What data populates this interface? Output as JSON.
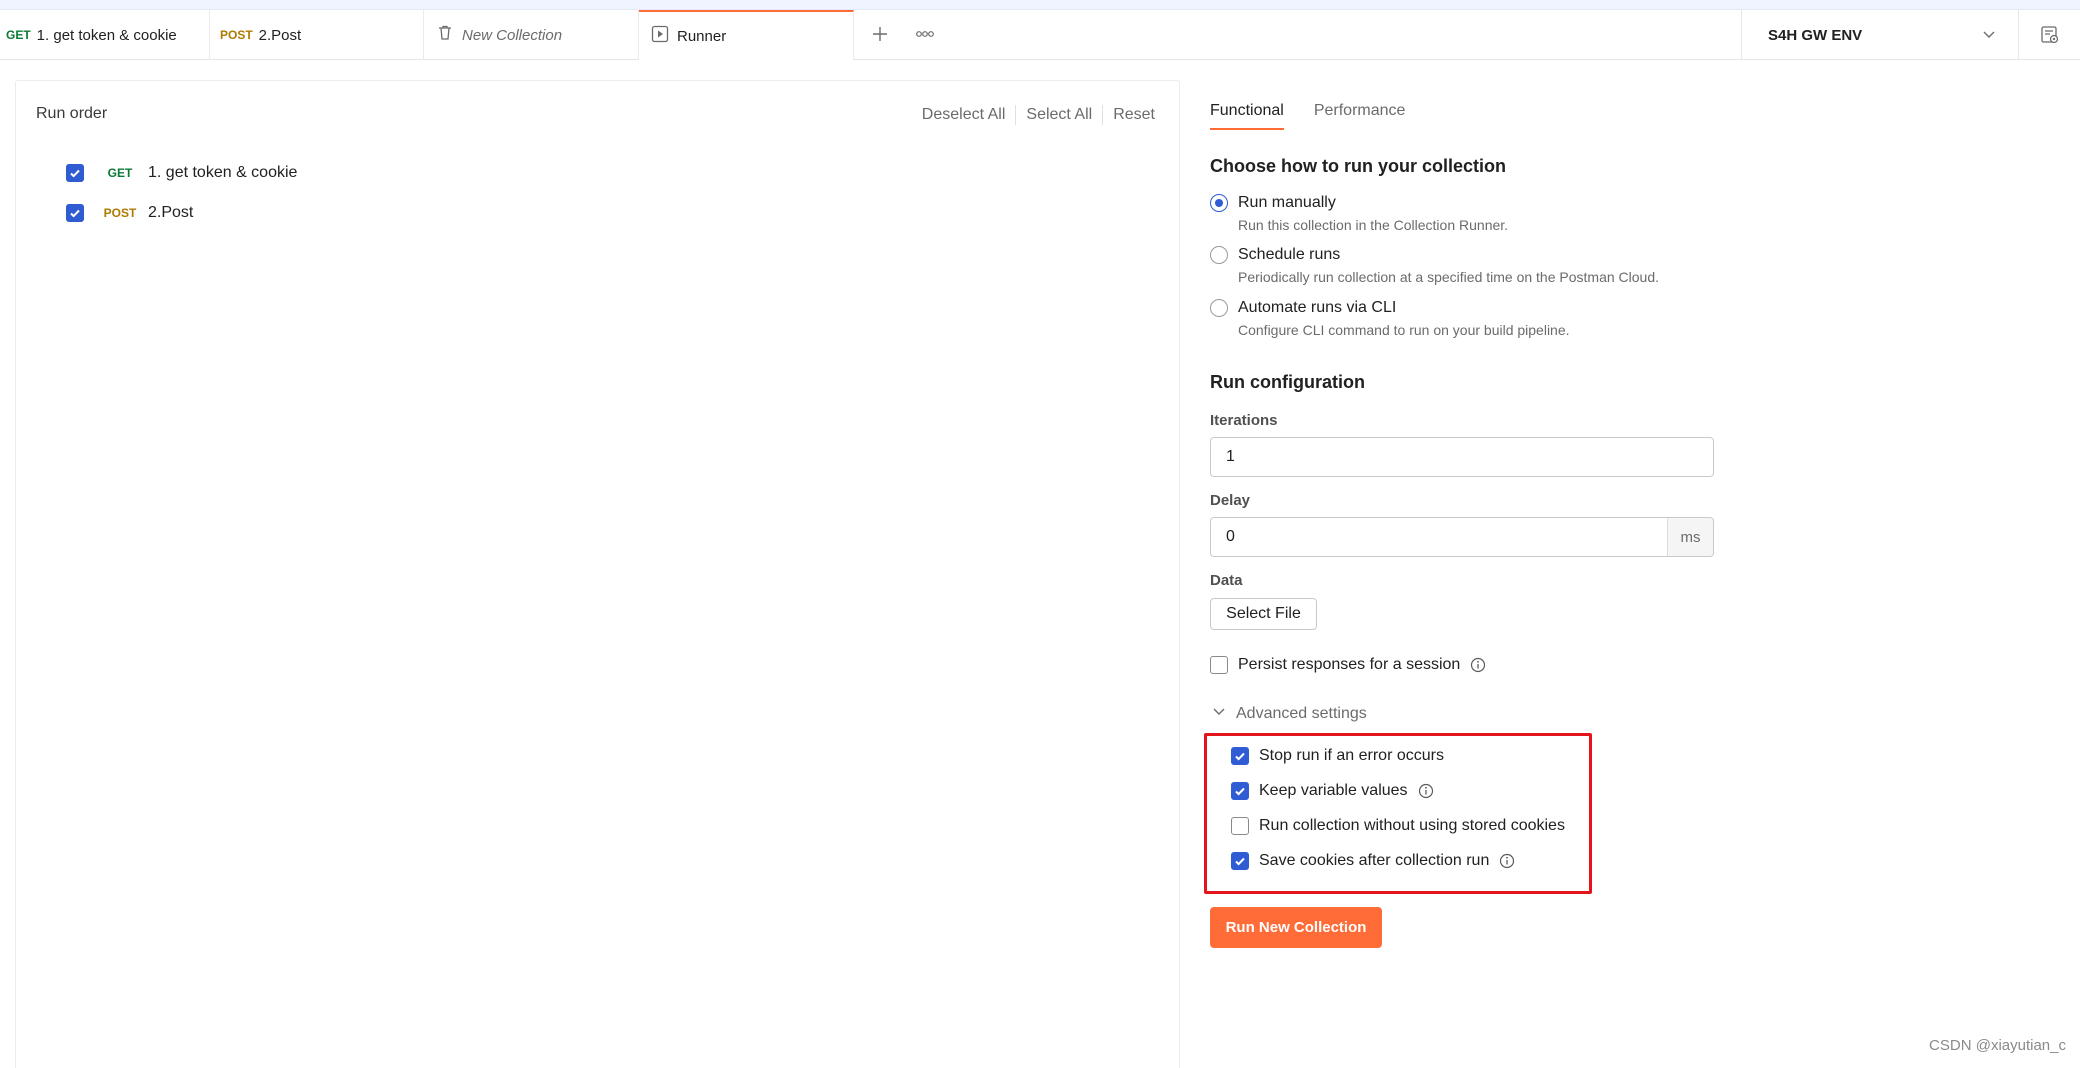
{
  "tabs": [
    {
      "method": "GET",
      "label": "1. get token & cookie"
    },
    {
      "method": "POST",
      "label": "2.Post"
    },
    {
      "method": "",
      "label": "New Collection"
    },
    {
      "method": "",
      "label": "Runner"
    }
  ],
  "environment": {
    "name": "S4H GW ENV"
  },
  "run_order": {
    "title": "Run order",
    "actions": {
      "deselect_all": "Deselect All",
      "select_all": "Select All",
      "reset": "Reset"
    },
    "requests": [
      {
        "method": "GET",
        "name": "1. get token & cookie",
        "checked": true
      },
      {
        "method": "POST",
        "name": "2.Post",
        "checked": true
      }
    ]
  },
  "runner": {
    "tabs": {
      "functional": "Functional",
      "performance": "Performance"
    },
    "choose_title": "Choose how to run your collection",
    "options": [
      {
        "label": "Run manually",
        "desc": "Run this collection in the Collection Runner.",
        "selected": true
      },
      {
        "label": "Schedule runs",
        "desc": "Periodically run collection at a specified time on the Postman Cloud.",
        "selected": false
      },
      {
        "label": "Automate runs via CLI",
        "desc": "Configure CLI command to run on your build pipeline.",
        "selected": false
      }
    ],
    "config_title": "Run configuration",
    "iterations": {
      "label": "Iterations",
      "value": "1"
    },
    "delay": {
      "label": "Delay",
      "value": "0",
      "unit": "ms"
    },
    "data": {
      "label": "Data",
      "button": "Select File"
    },
    "persist": {
      "label": "Persist responses for a session",
      "checked": false
    },
    "advanced": {
      "label": "Advanced settings",
      "options": [
        {
          "label": "Stop run if an error occurs",
          "checked": true
        },
        {
          "label": "Keep variable values",
          "checked": true
        },
        {
          "label": "Run collection without using stored cookies",
          "checked": false
        },
        {
          "label": "Save cookies after collection run",
          "checked": true
        }
      ]
    },
    "run_button": "Run New Collection"
  },
  "watermark": "CSDN @xiayutian_c",
  "colors": {
    "accent": "#ff6c37",
    "checkbox": "#2f5bd3",
    "get": "#0b7a34",
    "post": "#ad7a03",
    "highlight": "#e3141b"
  }
}
